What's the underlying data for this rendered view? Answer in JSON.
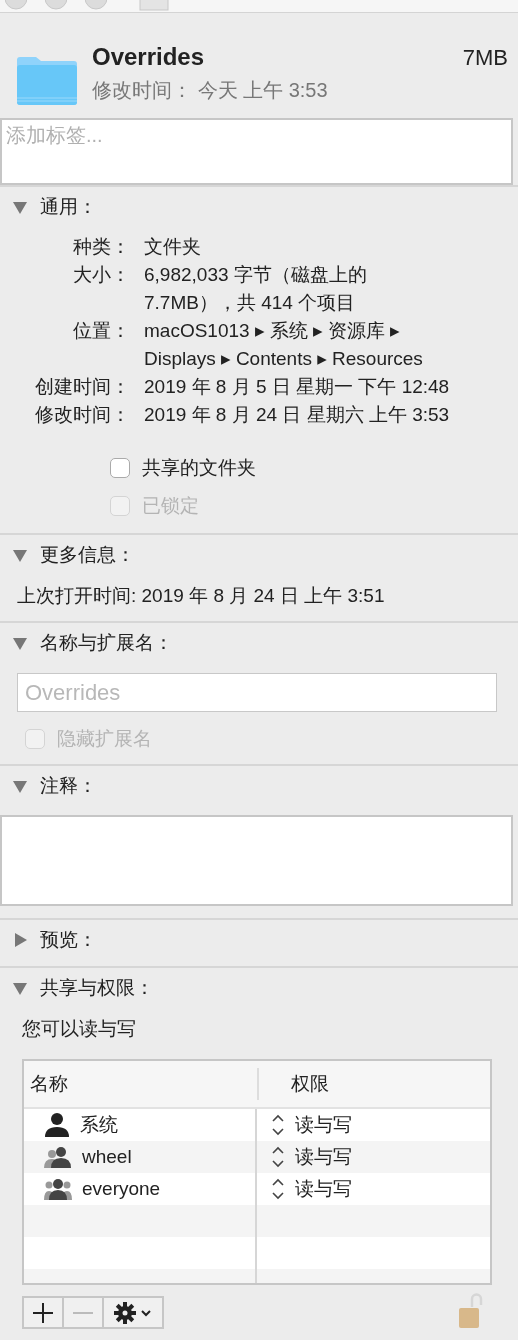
{
  "header": {
    "name": "Overrides",
    "size": "7MB",
    "modified": "修改时间： 今天 上午 3:53"
  },
  "tags": {
    "placeholder": "添加标签..."
  },
  "sections": [
    {
      "kind": "general",
      "title": "通用：",
      "expanded": true,
      "rows": [
        {
          "label": "种类：",
          "lines": [
            "文件夹"
          ]
        },
        {
          "label": "大小：",
          "lines": [
            "6,982,033 字节（磁盘上的",
            "7.7MB），共 414 个项目"
          ]
        },
        {
          "label": "位置：",
          "lines": [
            "macOS1013 ▸ 系统 ▸ 资源库 ▸",
            "Displays ▸ Contents ▸ Resources"
          ]
        },
        {
          "label": "创建时间：",
          "lines": [
            "2019 年 8 月 5 日 星期一 下午 12:48"
          ]
        },
        {
          "label": "修改时间：",
          "lines": [
            "2019 年 8 月 24 日 星期六 上午 3:53"
          ]
        }
      ],
      "checkboxes": [
        {
          "label": "共享的文件夹",
          "checked": false,
          "disabled": false
        },
        {
          "label": "已锁定",
          "checked": false,
          "disabled": true
        }
      ]
    },
    {
      "kind": "more",
      "title": "更多信息：",
      "expanded": true,
      "text": "上次打开时间: 2019 年 8 月 24 日 上午 3:51"
    },
    {
      "kind": "name",
      "title": "名称与扩展名：",
      "expanded": true,
      "field": {
        "value": "Overrides",
        "disabled": true
      },
      "checkbox": {
        "label": "隐藏扩展名",
        "checked": false,
        "disabled": true
      }
    },
    {
      "kind": "comments",
      "title": "注释：",
      "expanded": true
    },
    {
      "kind": "preview",
      "title": "预览：",
      "expanded": false
    },
    {
      "kind": "sharing",
      "title": "共享与权限：",
      "expanded": true,
      "note": "您可以读与写",
      "columns": [
        "名称",
        "权限"
      ],
      "rows": [
        {
          "kind": "user",
          "name": "系统",
          "privilege": "读与写"
        },
        {
          "kind": "group",
          "name": "wheel",
          "privilege": "读与写"
        },
        {
          "kind": "everyone",
          "name": "everyone",
          "privilege": "读与写"
        }
      ],
      "buttons": [
        {
          "kind": "add",
          "disabled": false
        },
        {
          "kind": "remove",
          "disabled": true
        },
        {
          "kind": "action",
          "disabled": false
        }
      ],
      "lock": {
        "locked": false
      }
    }
  ]
}
